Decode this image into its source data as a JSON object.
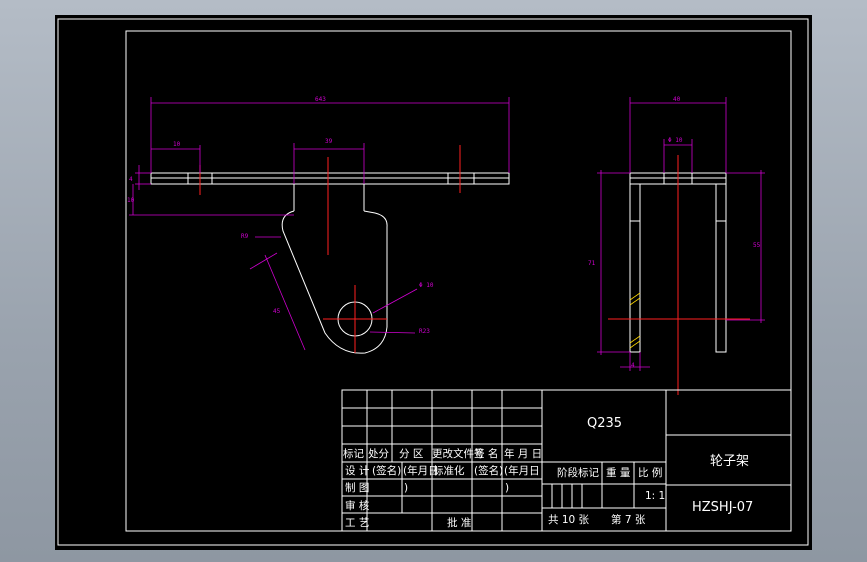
{
  "dimensions": {
    "overall_length": "643",
    "left_offset": "10",
    "top_width": "39",
    "plate_thickness": "4",
    "step_height": "10",
    "fillet_radius": "R9",
    "arm_length": "45",
    "hole_diameter": "Φ 10",
    "lower_radius": "R23",
    "side_width": "40",
    "side_hole": "Φ 10",
    "side_height_left": "71",
    "side_height_right": "55",
    "side_thickness": "4"
  },
  "title_block": {
    "material": "Q235",
    "part_name": "轮子架",
    "drawing_number": "HZSHJ-07",
    "scale_label": "比 例",
    "scale_value": "1: 1",
    "weight_label": "重 量",
    "stage_label": "阶段标记",
    "sheet_total": "共 10 张",
    "sheet_no": "第 7 张",
    "row_labels": {
      "biaoji": "标记",
      "chufen": "处分",
      "fenqu": "分 区",
      "wenjian": "更改文件号",
      "qianming": "签 名",
      "nianyueri": "年 月 日",
      "sheji": "设 计",
      "qianming2": "(签名)",
      "nianyueri2": "(年月日",
      "biaozhunhua": "标准化",
      "qianming3": "(签名)",
      "nianyueri3": "(年月日",
      "zhitu": "制 图",
      "bracket1": ")",
      "bracket2": ")",
      "shenhe": "审 核",
      "gongyi": "工 艺",
      "pizhun": "批 准"
    }
  },
  "colors": {
    "outline": "#ffffff",
    "dimension": "#d000d0",
    "centerline": "#ff2020",
    "hatch": "#ffd800"
  }
}
